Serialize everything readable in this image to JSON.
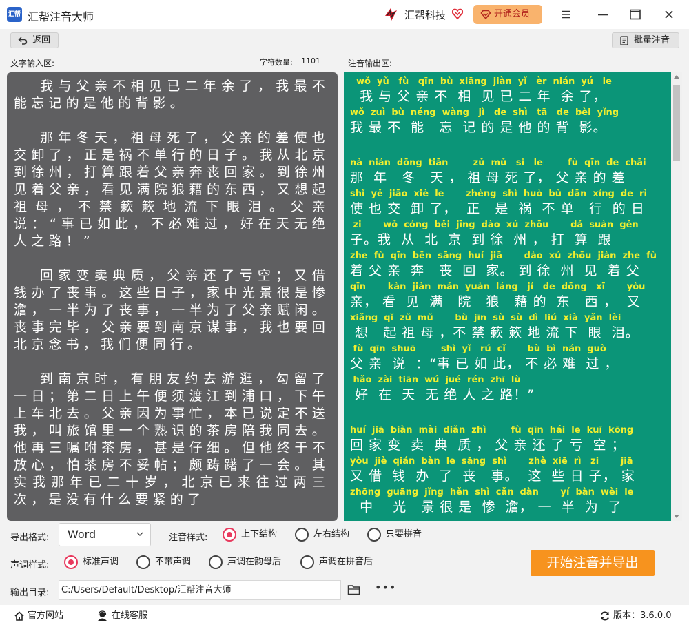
{
  "app": {
    "title": "汇帮注音大师",
    "logo_text": "汇帮"
  },
  "brand": {
    "name": "汇帮科技",
    "vip_label": "开通会员"
  },
  "toolbar": {
    "back_label": "返回",
    "batch_label": "批量注音"
  },
  "input": {
    "label": "文字输入区:",
    "char_count_label": "字符数量:",
    "char_count": "1101",
    "paragraphs": [
      "我与父亲不相见已二年余了，我最不能忘记的是他的背影。",
      "那年冬天，祖母死了，父亲的差使也交卸了，正是祸不单行的日子。我从北京到徐州，打算跟着父亲奔丧回家。到徐州见着父亲，看见满院狼藉的东西，又想起祖母，不禁簌簌地流下眼泪。父亲说：“事已如此，不必难过，好在天无绝人之路！”",
      "回家变卖典质，父亲还了亏空；又借钱办了丧事。这些日子，家中光景很是惨澹，一半为了丧事，一半为了父亲赋闲。丧事完毕，父亲要到南京谋事，我也要回北京念书，我们便同行。",
      "到南京时，有朋友约去游逛，勾留了一日；第二日上午便须渡江到浦口，下午上车北去。父亲因为事忙，本已说定不送我，叫旅馆里一个熟识的茶房陪我同去。他再三嘱咐茶房，甚是仔细。但他终于不放心，怕茶房不妥帖；颇踌躇了一会。其实我那年已二十岁，北京已来往过两三次，是没有什么要紧的了"
    ]
  },
  "output": {
    "label": "注音输出区:",
    "blocks": [
      [
        {
          "py": "  wǒ  yǔ   fù   qīn  bù  xiāng  jiàn  yǐ   èr  nián  yú   le",
          "hz": "  我 与 父 亲 不  相  见 已 二 年  余 了，"
        },
        {
          "py": "wǒ  zuì  bù  néng  wàng   jì   de  shì   tā   de  bèi  yǐng",
          "hz": "我 最 不  能   忘  记 的 是 他 的 背  影。"
        }
      ],
      [
        {
          "py": "nà  nián  dōng  tiān        zǔ  mǔ   sǐ   le        fù  qīn  de  chāi",
          "hz": "那  年   冬   天 ， 祖 母 死 了， 父 亲 的 差"
        },
        {
          "py": "shǐ  yě  jiāo  xiè  le       zhèng  shì  huò  bù  dān  xíng  de  rì",
          "hz": "使 也 交  卸 了，  正   是  祸  不 单   行  的 日"
        },
        {
          "py": " zi       wǒ  cóng  běi  jīng  dào  xú  zhōu       dǎ  suàn  gēn",
          "hz": "子。我  从  北  京  到 徐  州 ， 打  算  跟"
        },
        {
          "py": "zhe  fù  qīn  bēn  sāng  huí  jiā       dào  xú  zhōu  jiàn  zhe  fù",
          "hz": "着 父 亲  奔   丧  回  家。 到 徐  州  见  着 父"
        },
        {
          "py": "qīn       kàn  jiàn  mǎn  yuàn  láng   jí   de  dōng   xī       yòu",
          "hz": "亲， 看  见  满   院   狼   藉 的  东   西 ，  又"
        },
        {
          "py": "xiǎng  qǐ  zǔ  mǔ       bù  jīn  sù  sù  dì  liú  xià  yǎn  lèi",
          "hz": " 想   起 祖 母 ，不 禁 簌 簌 地 流 下  眼  泪。"
        },
        {
          "py": " fù  qīn  shuō        shì  yǐ   rú  cǐ       bù  bì  nán  guò",
          "hz": "父 亲  说  ：“事 已 如 此， 不 必 难  过 ，"
        },
        {
          "py": " hǎo  zài  tiān  wú  jué  rén  zhī  lù",
          "hz": " 好  在  天  无 绝 人 之 路！”"
        }
      ],
      [
        {
          "py": "huí  jiā  biàn  mài  diǎn  zhì        fù  qīn  hái  le  kuī  kōng",
          "hz": "回 家 变  卖  典  质 ， 父 亲 还 了 亏  空 ；"
        },
        {
          "py": "yòu  jiè  qián  bàn  le  sāng  shì       zhè  xiē  rì   zi       jiā",
          "hz": "又 借  钱  办  了  丧   事。  这  些 日 子， 家"
        },
        {
          "py": "zhōng  guāng  jǐng  hěn  shì  cǎn  dàn       yí  bàn  wèi  le",
          "hz": "  中    光   景 很 是  惨  澹， 一  半  为  了"
        }
      ]
    ]
  },
  "options": {
    "export_format_label": "导出格式:",
    "export_format_value": "Word",
    "phonetic_style_label": "注音样式:",
    "phonetic_styles": [
      "上下结构",
      "左右结构",
      "只要拼音"
    ],
    "phonetic_style_selected": 0,
    "tone_style_label": "声调样式:",
    "tone_styles": [
      "标准声调",
      "不带声调",
      "声调在韵母后",
      "声调在拼音后"
    ],
    "tone_style_selected": 0,
    "output_dir_label": "输出目录:",
    "output_dir_value": "C:/Users/Default/Desktop/汇帮注音大师",
    "start_button_label": "开始注音并导出"
  },
  "footer": {
    "website_label": "官方网站",
    "support_label": "在线客服",
    "version_label": "版本：",
    "version_value": "3.6.0.0"
  },
  "colors": {
    "accent": "#f7931e",
    "output_bg": "#0b9578",
    "input_bg": "#5f5f61",
    "pinyin": "#f1ee2f",
    "radio_checked": "#e8395d"
  }
}
